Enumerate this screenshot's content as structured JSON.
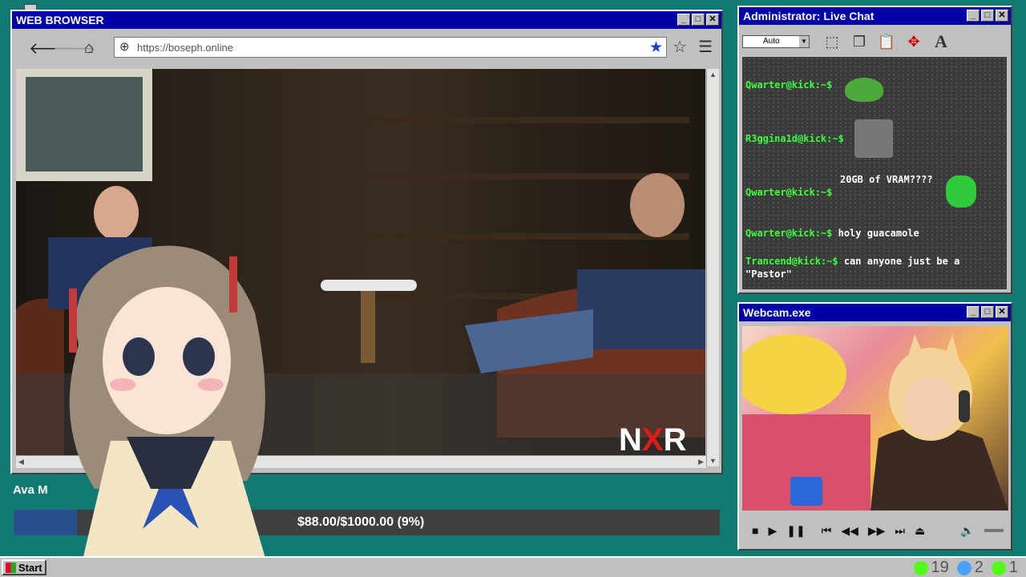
{
  "browser": {
    "title": "WEB BROWSER",
    "url": "https://boseph.online",
    "video_overlay_text": "NXR"
  },
  "chat": {
    "title": "Administrator: Live Chat",
    "zoom_select": "Auto",
    "messages": [
      {
        "user": "Qwarter@kick:~$",
        "text": ""
      },
      {
        "user": "R3ggina1d@kick:~$",
        "text": ""
      },
      {
        "user": "",
        "text": "20GB of VRAM????"
      },
      {
        "user": "Qwarter@kick:~$",
        "text": ""
      },
      {
        "user": "Qwarter@kick:~$",
        "text": "holy guacamole"
      },
      {
        "user": "Trancend@kick:~$",
        "text": "can anyone just be a"
      },
      {
        "user": "",
        "text": "\"Pastor\""
      }
    ]
  },
  "webcam": {
    "title": "Webcam.exe"
  },
  "donation": {
    "name": "Ava M",
    "progress_text": "$88.00/$1000.00 (9%)",
    "progress_fraction": 0.09
  },
  "taskbar": {
    "start_label": "Start",
    "tray": [
      {
        "icon": "kick-icon",
        "value": "19",
        "color": "#53fc18"
      },
      {
        "icon": "moon-icon",
        "value": "2",
        "color": "#4aa3ff"
      },
      {
        "icon": "play-icon",
        "value": "1",
        "color": "#53fc18"
      }
    ]
  }
}
